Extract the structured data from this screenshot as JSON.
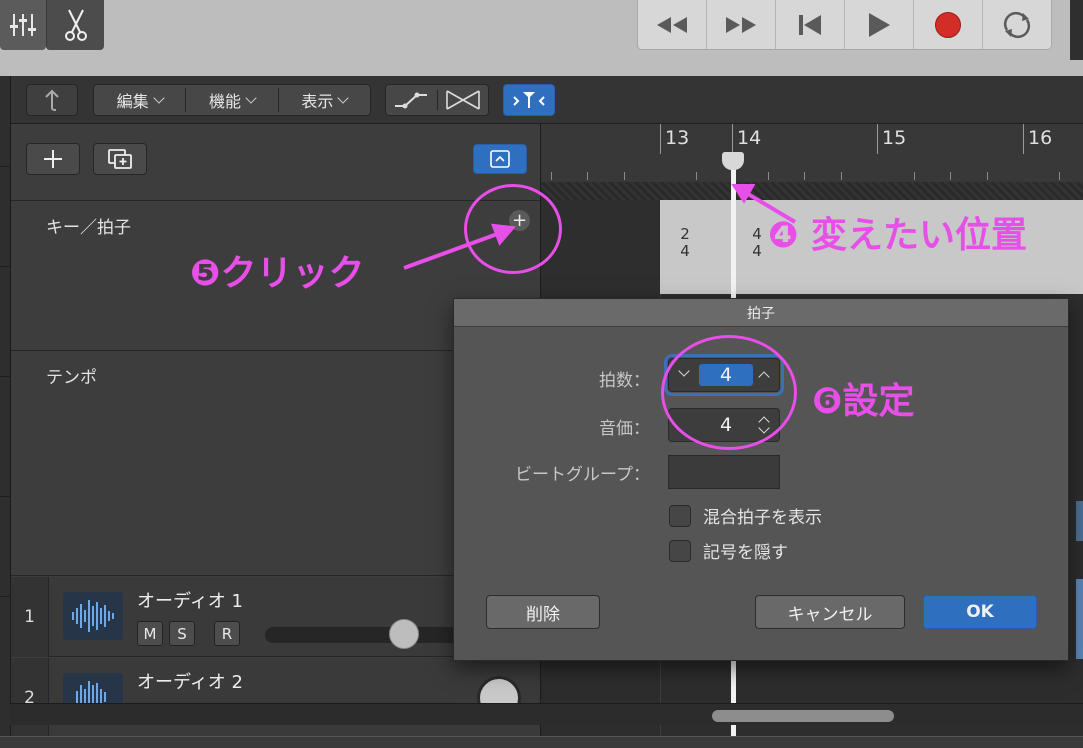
{
  "colors": {
    "annotation": "#e84ee8",
    "accent_blue": "#2f6fbf"
  },
  "topbar": {
    "mixer_icon": "sliders-icon",
    "scissors_icon": "scissors-icon",
    "transport": [
      "rewind-icon",
      "fast-forward-icon",
      "go-to-start-icon",
      "play-icon",
      "record-icon",
      "cycle-icon"
    ]
  },
  "toolbar": {
    "back_icon": "catch-up-arrow-icon",
    "menus": [
      "編集",
      "機能",
      "表示"
    ],
    "automation_icons": [
      "automation-curve-icon",
      "crossfade-icon"
    ],
    "flex_icon": "flex-icon"
  },
  "ruler": {
    "bars": [
      "13",
      "14",
      "15",
      "16"
    ]
  },
  "lanes": {
    "key_signature": "キー／拍子",
    "tempo": "テンポ"
  },
  "signatures": [
    {
      "top": "2",
      "bottom": "4"
    },
    {
      "top": "4",
      "bottom": "4"
    }
  ],
  "tracks": [
    {
      "number": "1",
      "name": "オーディオ 1",
      "buttons": [
        "M",
        "S",
        "R"
      ]
    },
    {
      "number": "2",
      "name": "オーディオ 2"
    }
  ],
  "dialog": {
    "title": "拍子",
    "beats_label": "拍数：",
    "beats_value": "4",
    "note_label": "音価：",
    "note_value": "4",
    "beat_group_label": "ビートグループ：",
    "beat_group_value": "",
    "mixed_meter_label": "混合拍子を表示",
    "mixed_meter_checked": false,
    "hide_symbol_label": "記号を隠す",
    "hide_symbol_checked": false,
    "delete_label": "削除",
    "cancel_label": "キャンセル",
    "ok_label": "OK"
  },
  "annotations": {
    "step4": "❹ 変えたい位置",
    "step5": "❺クリック",
    "step6": "❻設定"
  }
}
